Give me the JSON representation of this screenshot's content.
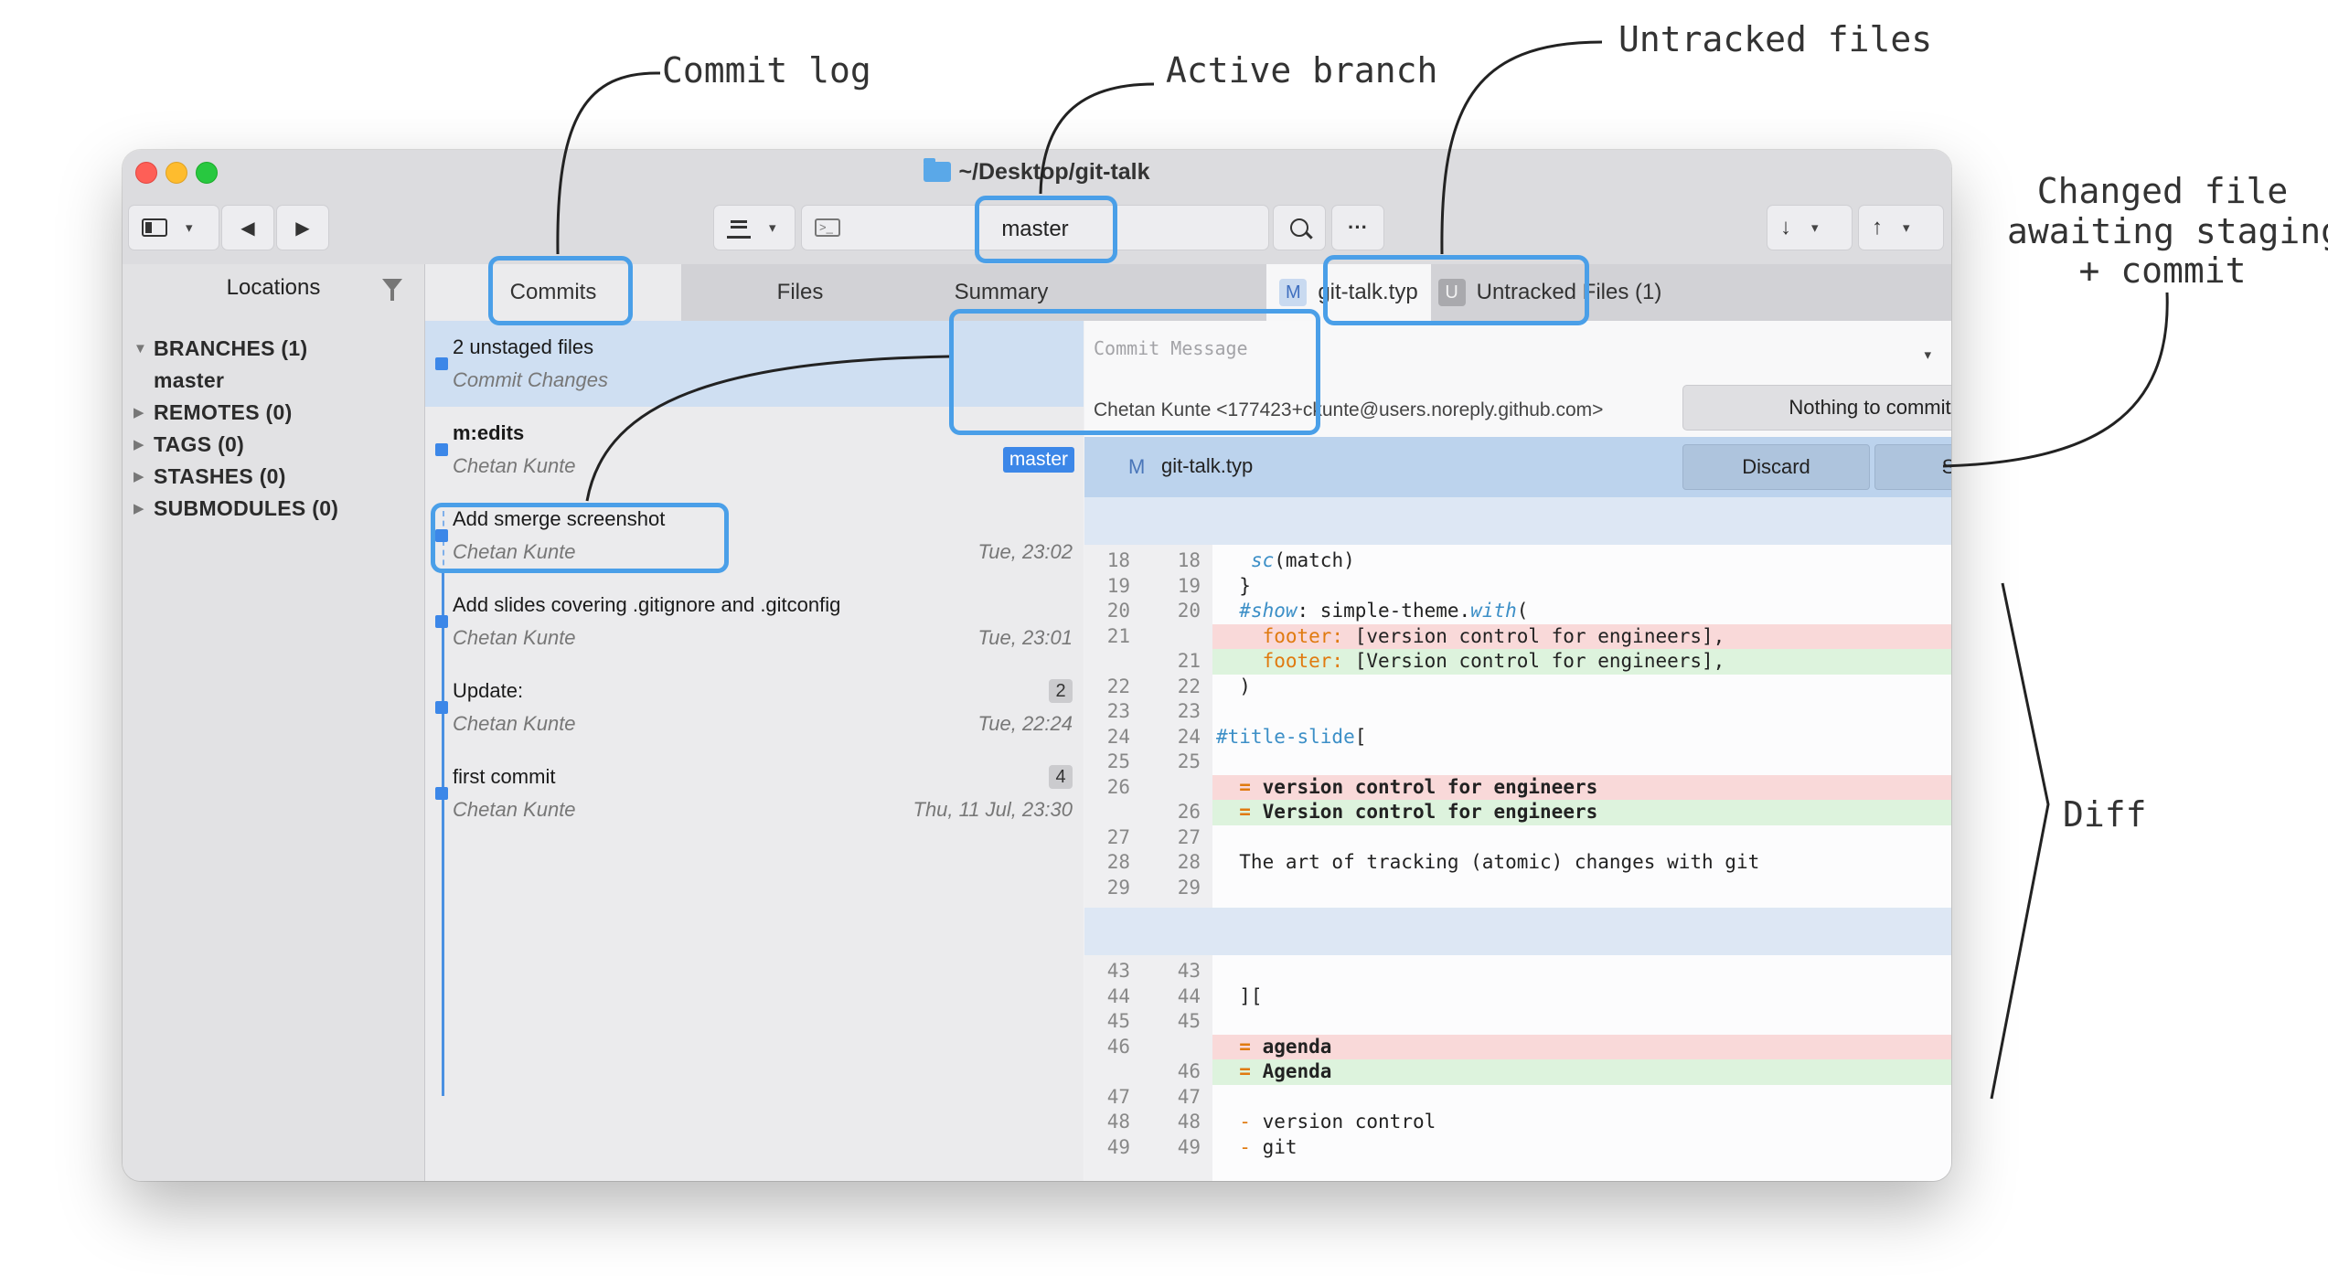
{
  "annotations": {
    "commit_log": "Commit log",
    "active_branch": "Active branch",
    "untracked_files": "Untracked files",
    "changed_file": "Changed file\nawaiting staging\n+ commit",
    "diff": "Diff"
  },
  "window": {
    "title": "~/Desktop/git-talk"
  },
  "toolbar": {
    "branch": "master",
    "terminal_glyph": ">_",
    "more_glyph": "···",
    "back_glyph": "◀",
    "forward_glyph": "▶",
    "fetch_glyph": "↓",
    "push_glyph": "↑",
    "caret": "▾"
  },
  "sidebar": {
    "title": "Locations",
    "items": [
      {
        "label": "BRANCHES (1)",
        "expanded": true
      },
      {
        "label": "master",
        "child": true
      },
      {
        "label": "REMOTES (0)",
        "expanded": false
      },
      {
        "label": "TAGS (0)",
        "expanded": false
      },
      {
        "label": "STASHES (0)",
        "expanded": false
      },
      {
        "label": "SUBMODULES (0)",
        "expanded": false
      }
    ]
  },
  "tabs": [
    {
      "label": "Commits"
    },
    {
      "label": "Files"
    },
    {
      "label": "Summary"
    },
    {
      "label": "git-talk.typ",
      "badge": "M"
    },
    {
      "label": "Untracked Files (1)",
      "badge": "U"
    }
  ],
  "commits": [
    {
      "title": "2 unstaged files",
      "author": "Commit Changes",
      "date": "",
      "count": "",
      "tag": "",
      "selected": true
    },
    {
      "title": "m:edits",
      "author": "Chetan Kunte",
      "date": "",
      "count": "",
      "tag": "master",
      "bold": true
    },
    {
      "title": "Add smerge screenshot",
      "author": "Chetan Kunte",
      "date": "Tue, 23:02",
      "count": "",
      "tag": ""
    },
    {
      "title": "Add slides covering .gitignore and .gitconfig",
      "author": "Chetan Kunte",
      "date": "Tue, 23:01",
      "count": "",
      "tag": ""
    },
    {
      "title": "Update:",
      "author": "Chetan Kunte",
      "date": "Tue, 22:24",
      "count": "2",
      "tag": ""
    },
    {
      "title": "first commit",
      "author": "Chetan Kunte",
      "date": "Thu, 11 Jul, 23:30",
      "count": "4",
      "tag": ""
    }
  ],
  "commit_message": {
    "placeholder": "Commit Message",
    "author": "Chetan Kunte <177423+ckunte@users.noreply.github.com>",
    "button": "Nothing to commit"
  },
  "file_header": {
    "status": "M",
    "name": "git-talk.typ",
    "discard": "Discard",
    "stage": "Stage"
  },
  "diff_hunks": [
    {
      "lines": [
        {
          "n1": "18",
          "n2": "18",
          "type": "ctx",
          "code": "   sc(match)"
        },
        {
          "n1": "19",
          "n2": "19",
          "type": "ctx",
          "code": "  }"
        },
        {
          "n1": "20",
          "n2": "20",
          "type": "ctx",
          "code": "  #show: simple-theme.with("
        },
        {
          "n1": "21",
          "n2": "",
          "type": "del",
          "code": "    footer: [version control for engineers],"
        },
        {
          "n1": "",
          "n2": "21",
          "type": "add",
          "code": "    footer: [Version control for engineers],"
        },
        {
          "n1": "22",
          "n2": "22",
          "type": "ctx",
          "code": "  )"
        },
        {
          "n1": "23",
          "n2": "23",
          "type": "ctx",
          "code": ""
        },
        {
          "n1": "24",
          "n2": "24",
          "type": "ctx",
          "code": "#title-slide["
        },
        {
          "n1": "25",
          "n2": "25",
          "type": "ctx",
          "code": ""
        },
        {
          "n1": "26",
          "n2": "",
          "type": "del",
          "code": "  = version control for engineers"
        },
        {
          "n1": "",
          "n2": "26",
          "type": "add",
          "code": "  = Version control for engineers"
        },
        {
          "n1": "27",
          "n2": "27",
          "type": "ctx",
          "code": ""
        },
        {
          "n1": "28",
          "n2": "28",
          "type": "ctx",
          "code": "  The art of tracking (atomic) changes with git"
        },
        {
          "n1": "29",
          "n2": "29",
          "type": "ctx",
          "code": ""
        }
      ]
    },
    {
      "lines": [
        {
          "n1": "43",
          "n2": "43",
          "type": "ctx",
          "code": ""
        },
        {
          "n1": "44",
          "n2": "44",
          "type": "ctx",
          "code": "  ]["
        },
        {
          "n1": "45",
          "n2": "45",
          "type": "ctx",
          "code": ""
        },
        {
          "n1": "46",
          "n2": "",
          "type": "del",
          "code": "  = agenda"
        },
        {
          "n1": "",
          "n2": "46",
          "type": "add",
          "code": "  = Agenda"
        },
        {
          "n1": "47",
          "n2": "47",
          "type": "ctx",
          "code": ""
        },
        {
          "n1": "48",
          "n2": "48",
          "type": "ctx",
          "code": "  - version control"
        },
        {
          "n1": "49",
          "n2": "49",
          "type": "ctx",
          "code": "  - git"
        }
      ]
    }
  ],
  "colors": {
    "accent": "#4a9fe8",
    "deleted": "#f9d9d9",
    "added": "#ddf3dd",
    "selection": "#cfdff2"
  }
}
